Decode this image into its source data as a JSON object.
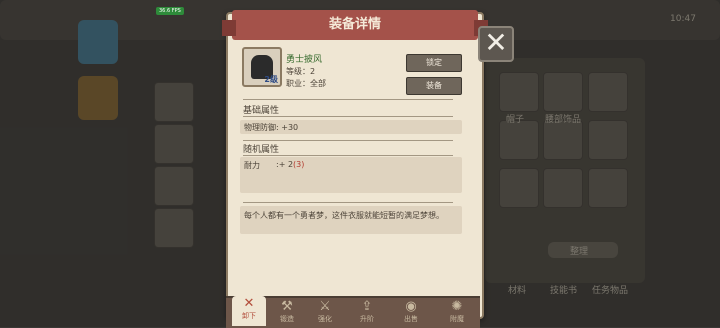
{
  "overlay": {
    "fps_badge": "36.6 FPS"
  },
  "modal": {
    "title": "装备详情",
    "close_symbol": "✕",
    "item": {
      "name": "勇士披风",
      "level_badge": "2级",
      "level_line": "等级：2",
      "class_line": "职业：全部",
      "icon": "hooded-cloak-icon"
    },
    "buttons": {
      "lock": "锁定",
      "equip": "装备"
    },
    "base_section": {
      "title": "基础属性",
      "attributes": [
        {
          "label": "物理防御: +30"
        }
      ]
    },
    "random_section": {
      "title": "随机属性",
      "attributes": [
        {
          "name": "耐力",
          "value": ":+ 2",
          "extra": "(3)"
        }
      ]
    },
    "description": "每个人都有一个勇者梦，这件衣服就能短暂的满足梦想。"
  },
  "bottom_tabs": [
    {
      "label": "卸下",
      "icon": "unequip-icon",
      "active": true
    },
    {
      "label": "锻造",
      "icon": "forge-icon",
      "active": false
    },
    {
      "label": "强化",
      "icon": "enhance-icon",
      "active": false
    },
    {
      "label": "升阶",
      "icon": "upgrade-icon",
      "active": false
    },
    {
      "label": "出售",
      "icon": "sell-icon",
      "active": false
    },
    {
      "label": "附魔",
      "icon": "enchant-icon",
      "active": false
    }
  ],
  "background": {
    "right_button": "整理",
    "item_labels": [
      "帽子",
      "腰部饰品"
    ],
    "bottom_labels": [
      "材料",
      "技能书",
      "任务物品"
    ],
    "top_right_time": "10:47"
  },
  "colors": {
    "banner": "#a4524a",
    "modal_bg": "#efe6d3",
    "active_tab": "#b24d3b"
  }
}
